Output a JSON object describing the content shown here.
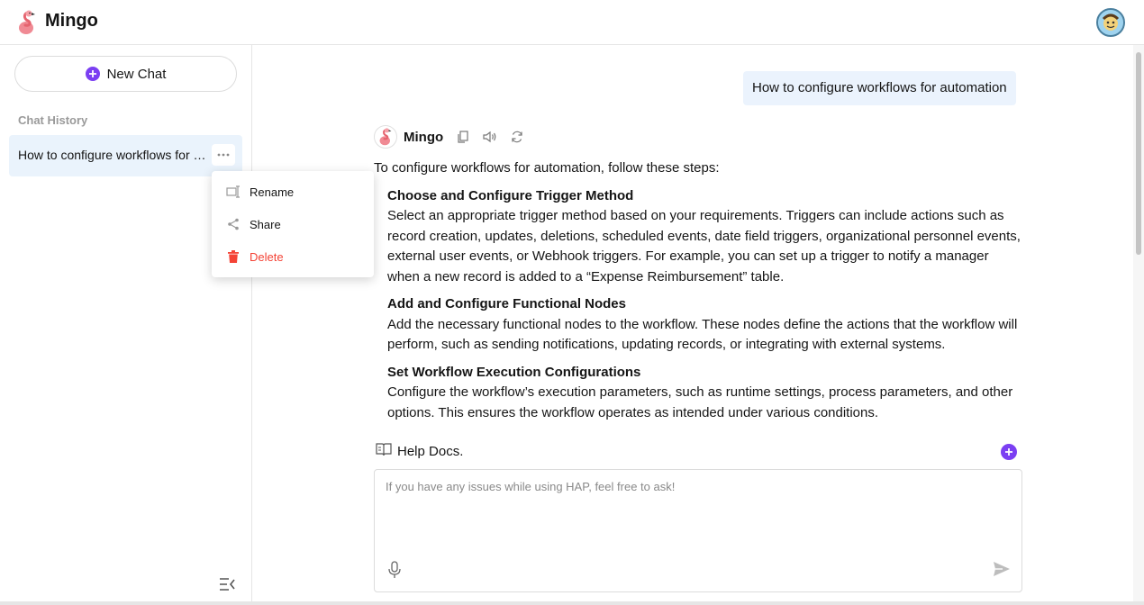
{
  "app": {
    "title": "Mingo"
  },
  "sidebar": {
    "new_chat_label": "New Chat",
    "history_label": "Chat History",
    "history_items": [
      {
        "label": "How to configure workflows for automation"
      }
    ]
  },
  "context_menu": {
    "items": [
      {
        "label": "Rename",
        "icon": "rename-icon"
      },
      {
        "label": "Share",
        "icon": "share-icon"
      },
      {
        "label": "Delete",
        "icon": "trash-icon",
        "color": "#f44336"
      }
    ]
  },
  "conversation": {
    "user_message": "How to configure workflows for automation",
    "bot_name": "Mingo",
    "answer_intro": "To configure workflows for automation, follow these steps:",
    "steps": [
      {
        "title": "Choose and Configure Trigger Method",
        "body": "Select an appropriate trigger method based on your requirements. Triggers can include actions such as record creation, updates, deletions, scheduled events, date field triggers, organizational personnel events, external user events, or Webhook triggers. For example, you can set up a trigger to notify a manager when a new record is added to a “Expense Reimbursement” table."
      },
      {
        "title": "Add and Configure Functional Nodes",
        "body": "Add the necessary functional nodes to the workflow. These nodes define the actions that the workflow will perform, such as sending notifications, updating records, or integrating with external systems."
      },
      {
        "title": "Set Workflow Execution Configurations",
        "body": "Configure the workflow’s execution parameters, such as runtime settings, process parameters, and other options. This ensures the workflow operates as intended under various conditions."
      }
    ]
  },
  "composer": {
    "help_docs_label": "Help Docs.",
    "placeholder": "If you have any issues while using HAP, feel free to ask!"
  },
  "colors": {
    "accent": "#7b3ff2",
    "selected_bg": "#eaf3fc",
    "user_bubble_bg": "#ebf3fd",
    "danger": "#f44336"
  }
}
